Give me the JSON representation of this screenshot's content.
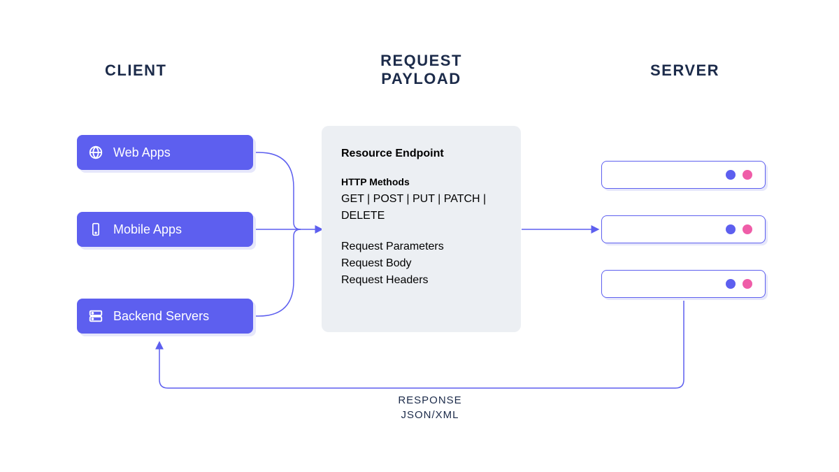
{
  "headings": {
    "client": "CLIENT",
    "payload_line1": "REQUEST",
    "payload_line2": "PAYLOAD",
    "server": "SERVER"
  },
  "clients": [
    {
      "icon": "globe",
      "label": "Web Apps"
    },
    {
      "icon": "mobile",
      "label": "Mobile Apps"
    },
    {
      "icon": "server",
      "label": "Backend Servers"
    }
  ],
  "payload": {
    "title": "Resource Endpoint",
    "methods_heading": "HTTP Methods",
    "methods": "GET | POST | PUT | PATCH | DELETE",
    "lines": [
      "Request Parameters",
      "Request Body",
      "Request Headers"
    ]
  },
  "response": {
    "line1": "RESPONSE",
    "line2": "JSON/XML"
  },
  "server_nodes": 3,
  "colors": {
    "accent": "#5d5fef",
    "pink": "#ef5da8",
    "heading": "#1c2b4a",
    "panel": "#eceff3"
  }
}
